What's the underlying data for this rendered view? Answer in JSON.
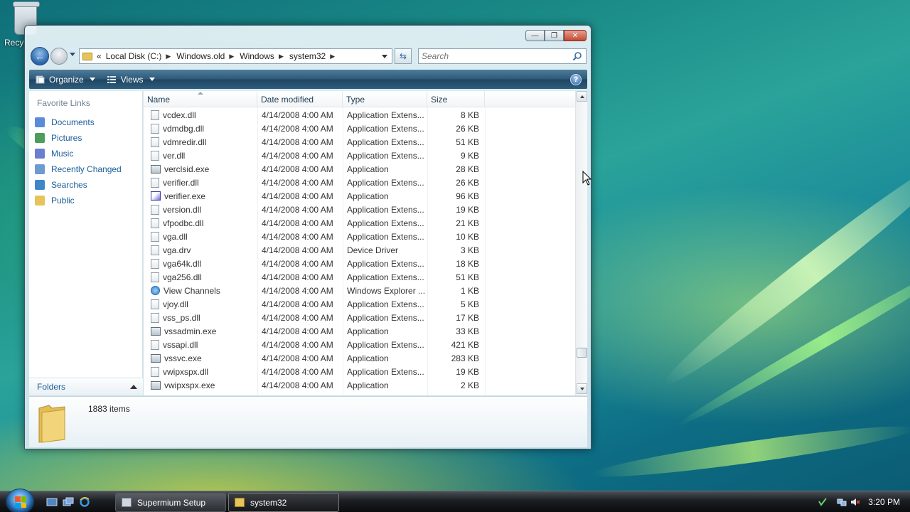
{
  "desktop": {
    "recycle_label": "Recy"
  },
  "window": {
    "controls": {
      "minimize": "—",
      "maximize": "❐",
      "close": "✕"
    },
    "breadcrumb": {
      "overflow": "«",
      "items": [
        "Local Disk (C:)",
        "Windows.old",
        "Windows",
        "system32"
      ]
    },
    "search_placeholder": "Search",
    "toolbar": {
      "organize": "Organize",
      "views": "Views",
      "help": "?"
    },
    "nav": {
      "heading": "Favorite Links",
      "items": [
        {
          "label": "Documents",
          "icon": "documents-icon",
          "color": "#5a8bd6"
        },
        {
          "label": "Pictures",
          "icon": "pictures-icon",
          "color": "#4f9d5b"
        },
        {
          "label": "Music",
          "icon": "music-icon",
          "color": "#6b7fcf"
        },
        {
          "label": "Recently Changed",
          "icon": "recently-changed-icon",
          "color": "#6c9bd0"
        },
        {
          "label": "Searches",
          "icon": "searches-icon",
          "color": "#3f86c9"
        },
        {
          "label": "Public",
          "icon": "public-folder-icon",
          "color": "#e6c45a"
        }
      ],
      "folders_label": "Folders"
    },
    "columns": [
      "Name",
      "Date modified",
      "Type",
      "Size"
    ],
    "files": [
      {
        "name": "vcdex.dll",
        "date": "4/14/2008 4:00 AM",
        "type": "Application Extens...",
        "size": "8 KB",
        "icon": "dll"
      },
      {
        "name": "vdmdbg.dll",
        "date": "4/14/2008 4:00 AM",
        "type": "Application Extens...",
        "size": "26 KB",
        "icon": "dll"
      },
      {
        "name": "vdmredir.dll",
        "date": "4/14/2008 4:00 AM",
        "type": "Application Extens...",
        "size": "51 KB",
        "icon": "dll"
      },
      {
        "name": "ver.dll",
        "date": "4/14/2008 4:00 AM",
        "type": "Application Extens...",
        "size": "9 KB",
        "icon": "dll"
      },
      {
        "name": "verclsid.exe",
        "date": "4/14/2008 4:00 AM",
        "type": "Application",
        "size": "28 KB",
        "icon": "app"
      },
      {
        "name": "verifier.dll",
        "date": "4/14/2008 4:00 AM",
        "type": "Application Extens...",
        "size": "26 KB",
        "icon": "dll"
      },
      {
        "name": "verifier.exe",
        "date": "4/14/2008 4:00 AM",
        "type": "Application",
        "size": "96 KB",
        "icon": "chk"
      },
      {
        "name": "version.dll",
        "date": "4/14/2008 4:00 AM",
        "type": "Application Extens...",
        "size": "19 KB",
        "icon": "dll"
      },
      {
        "name": "vfpodbc.dll",
        "date": "4/14/2008 4:00 AM",
        "type": "Application Extens...",
        "size": "21 KB",
        "icon": "dll"
      },
      {
        "name": "vga.dll",
        "date": "4/14/2008 4:00 AM",
        "type": "Application Extens...",
        "size": "10 KB",
        "icon": "dll"
      },
      {
        "name": "vga.drv",
        "date": "4/14/2008 4:00 AM",
        "type": "Device Driver",
        "size": "3 KB",
        "icon": "dll"
      },
      {
        "name": "vga64k.dll",
        "date": "4/14/2008 4:00 AM",
        "type": "Application Extens...",
        "size": "18 KB",
        "icon": "dll"
      },
      {
        "name": "vga256.dll",
        "date": "4/14/2008 4:00 AM",
        "type": "Application Extens...",
        "size": "51 KB",
        "icon": "dll"
      },
      {
        "name": "View Channels",
        "date": "4/14/2008 4:00 AM",
        "type": "Windows Explorer ...",
        "size": "1 KB",
        "icon": "ie"
      },
      {
        "name": "vjoy.dll",
        "date": "4/14/2008 4:00 AM",
        "type": "Application Extens...",
        "size": "5 KB",
        "icon": "dll"
      },
      {
        "name": "vss_ps.dll",
        "date": "4/14/2008 4:00 AM",
        "type": "Application Extens...",
        "size": "17 KB",
        "icon": "dll"
      },
      {
        "name": "vssadmin.exe",
        "date": "4/14/2008 4:00 AM",
        "type": "Application",
        "size": "33 KB",
        "icon": "app"
      },
      {
        "name": "vssapi.dll",
        "date": "4/14/2008 4:00 AM",
        "type": "Application Extens...",
        "size": "421 KB",
        "icon": "dll"
      },
      {
        "name": "vssvc.exe",
        "date": "4/14/2008 4:00 AM",
        "type": "Application",
        "size": "283 KB",
        "icon": "app"
      },
      {
        "name": "vwipxspx.dll",
        "date": "4/14/2008 4:00 AM",
        "type": "Application Extens...",
        "size": "19 KB",
        "icon": "dll"
      },
      {
        "name": "vwipxspx.exe",
        "date": "4/14/2008 4:00 AM",
        "type": "Application",
        "size": "2 KB",
        "icon": "app"
      }
    ],
    "status": {
      "item_count": "1883 items"
    }
  },
  "taskbar": {
    "buttons": [
      {
        "label": "Supermium Setup",
        "active": false
      },
      {
        "label": "system32",
        "active": true
      }
    ],
    "clock": "3:20 PM"
  }
}
